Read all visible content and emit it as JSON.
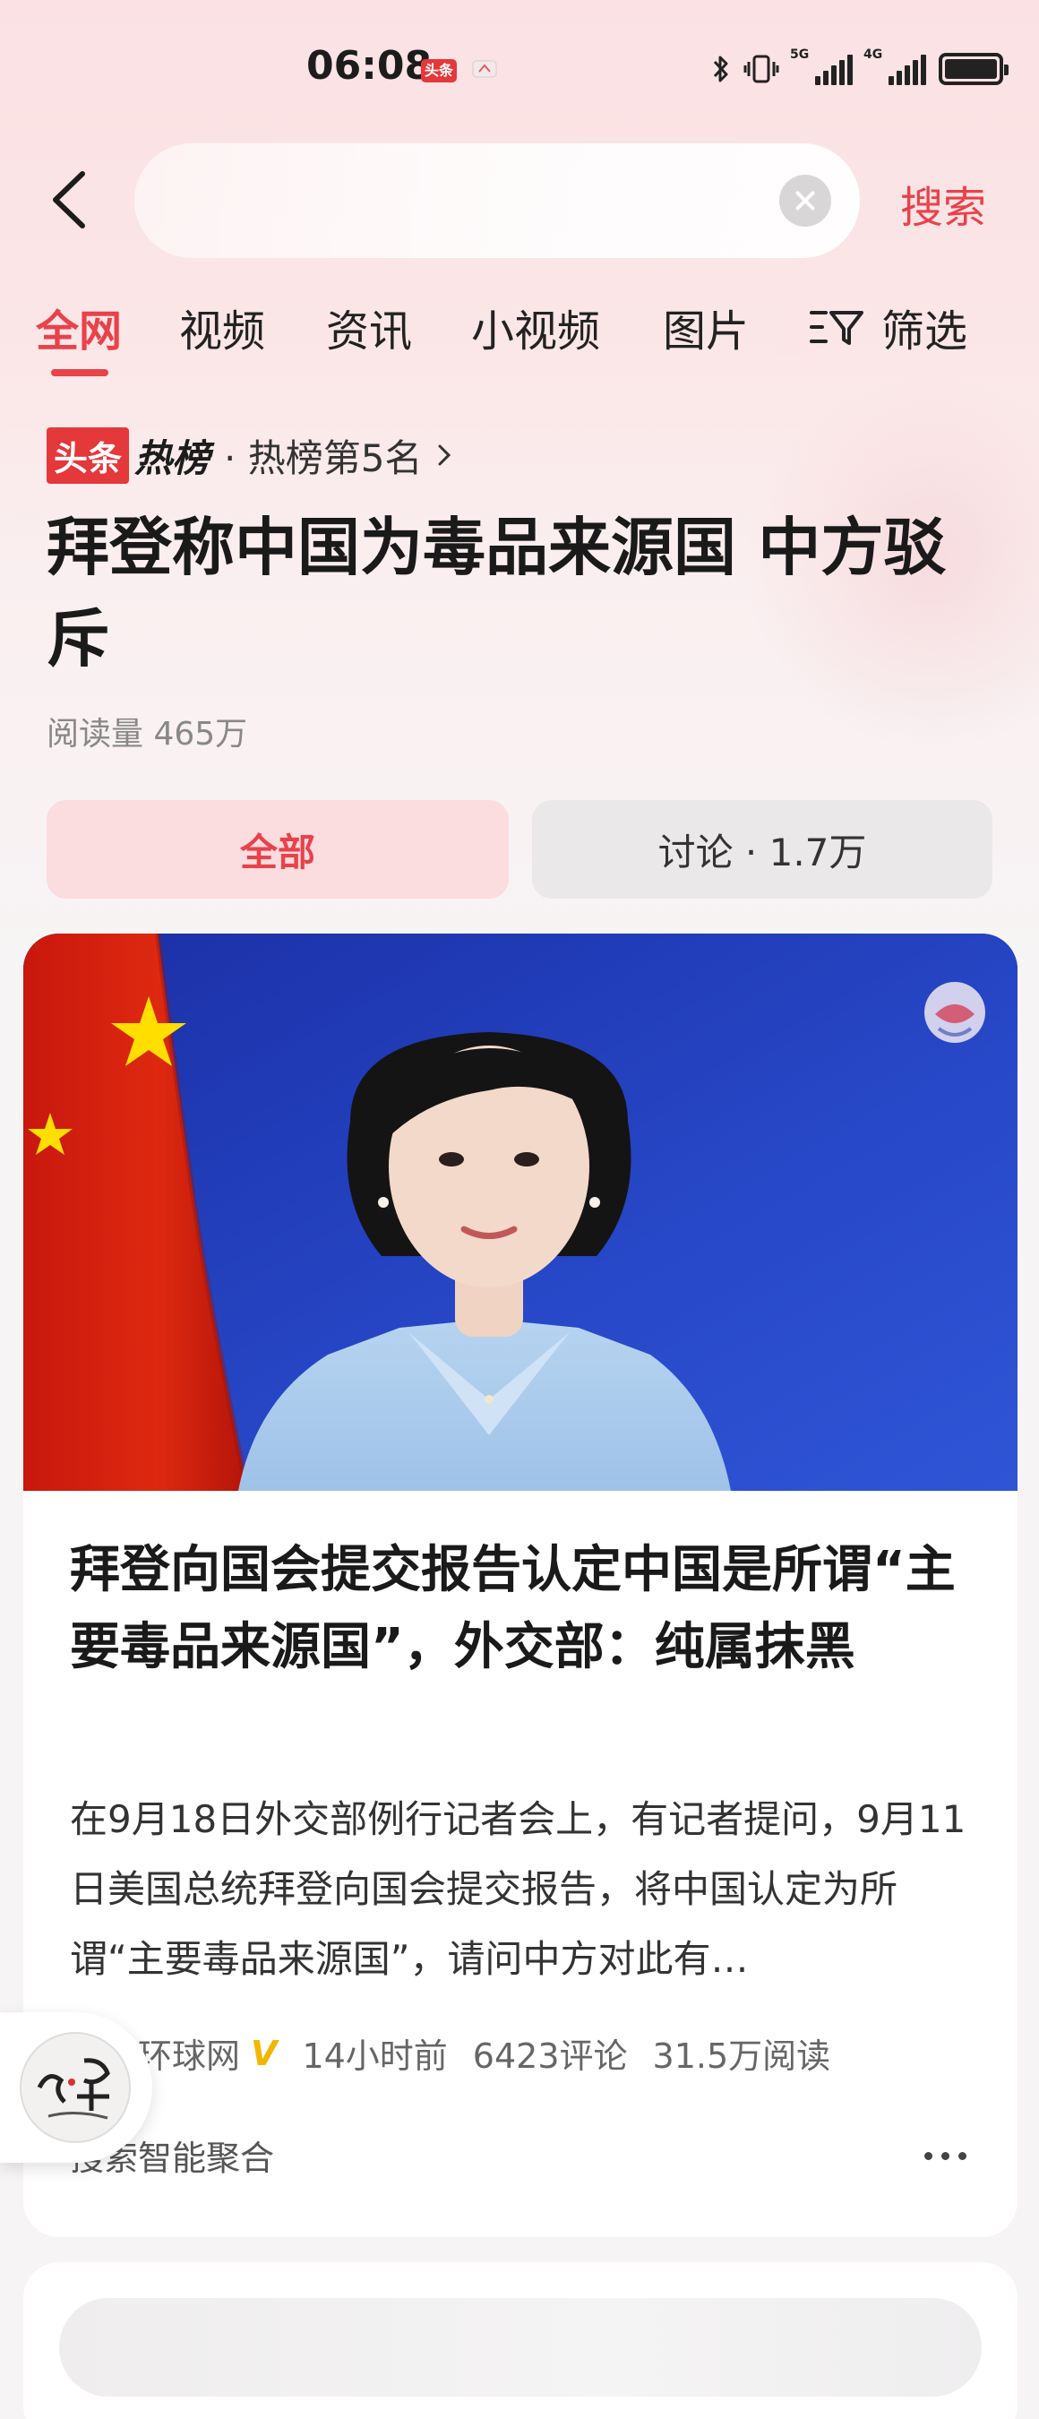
{
  "status_bar": {
    "time": "06:08",
    "app_badge": "头条",
    "network1": "5G",
    "network2": "4G",
    "battery_level": 1.0
  },
  "search": {
    "query": "",
    "button_label": "搜索"
  },
  "tabs": [
    {
      "label": "全网",
      "active": true
    },
    {
      "label": "视频",
      "active": false
    },
    {
      "label": "资讯",
      "active": false
    },
    {
      "label": "小视频",
      "active": false
    },
    {
      "label": "图片",
      "active": false
    }
  ],
  "filter_label": "筛选",
  "hot": {
    "logo_left": "头条",
    "logo_right": "热榜",
    "rank_text": "· 热榜第5名",
    "headline": "拜登称中国为毒品来源国 中方驳斥",
    "reads": "阅读量 465万"
  },
  "segments": {
    "all": "全部",
    "discussion": "讨论 · 1.7万"
  },
  "card": {
    "title": "拜登向国会提交报告认定中国是所谓“主要毒品来源国”，外交部：纯属抹黑",
    "summary": "在9月18日外交部例行记者会上，有记者提问，9月11日美国总统拜登向国会提交报告，将中国认定为所谓“主要毒品来源国”，请问中方对此有…",
    "source": "环球网",
    "verified_badge": "V",
    "time_ago": "14小时前",
    "comments": "6423评论",
    "reads": "31.5万阅读",
    "aggregation": "搜索智能聚合"
  },
  "colors": {
    "accent": "#e9424a",
    "flag_red": "#de2910",
    "flag_yellow": "#ffde00",
    "backdrop_blue": "#2440c4"
  },
  "icons": [
    "back-chevron-icon",
    "clear-icon",
    "filter-icon",
    "chevron-right-icon",
    "more-icon"
  ]
}
